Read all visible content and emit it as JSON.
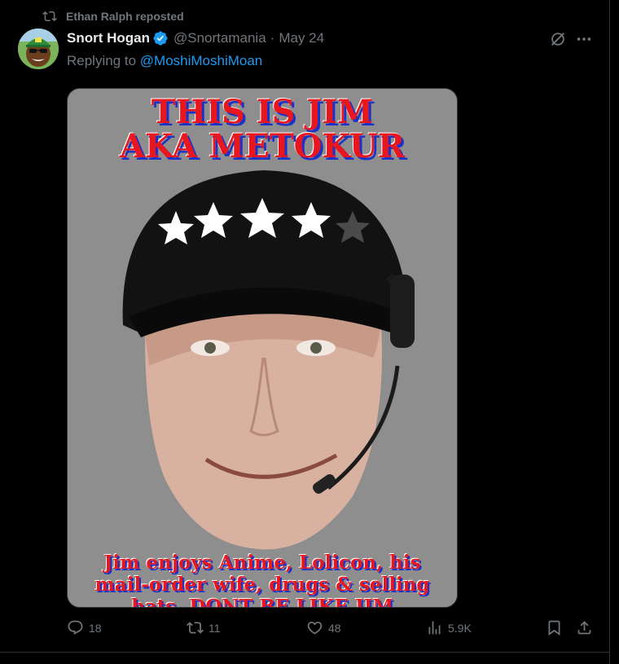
{
  "repost": {
    "text": "Ethan Ralph reposted",
    "icon": "repost-icon"
  },
  "author": {
    "display_name": "Snort Hogan",
    "handle": "@Snortamania",
    "separator": "·",
    "date": "May 24",
    "verified": true
  },
  "reply": {
    "prefix": "Replying to ",
    "mention": "@MoshiMoshiMoan"
  },
  "media": {
    "headline_line1": "THIS IS JIM",
    "headline_line2": "AKA METOKUR",
    "caption_line1": "Jim enjoys Anime, Lolicon, his",
    "caption_line2": "mail-order wife, drugs & selling",
    "caption_line3": "hats. DONT BE LIKE JIM",
    "stars": 4,
    "stars_total": 5
  },
  "actions": {
    "replies": "18",
    "reposts": "11",
    "likes": "48",
    "views": "5.9K"
  },
  "colors": {
    "background": "#000000",
    "text_primary": "#e7e9ea",
    "text_secondary": "#71767b",
    "accent": "#1d9bf0",
    "headline_red": "#e8171f",
    "headline_blue": "#1a32c8"
  }
}
